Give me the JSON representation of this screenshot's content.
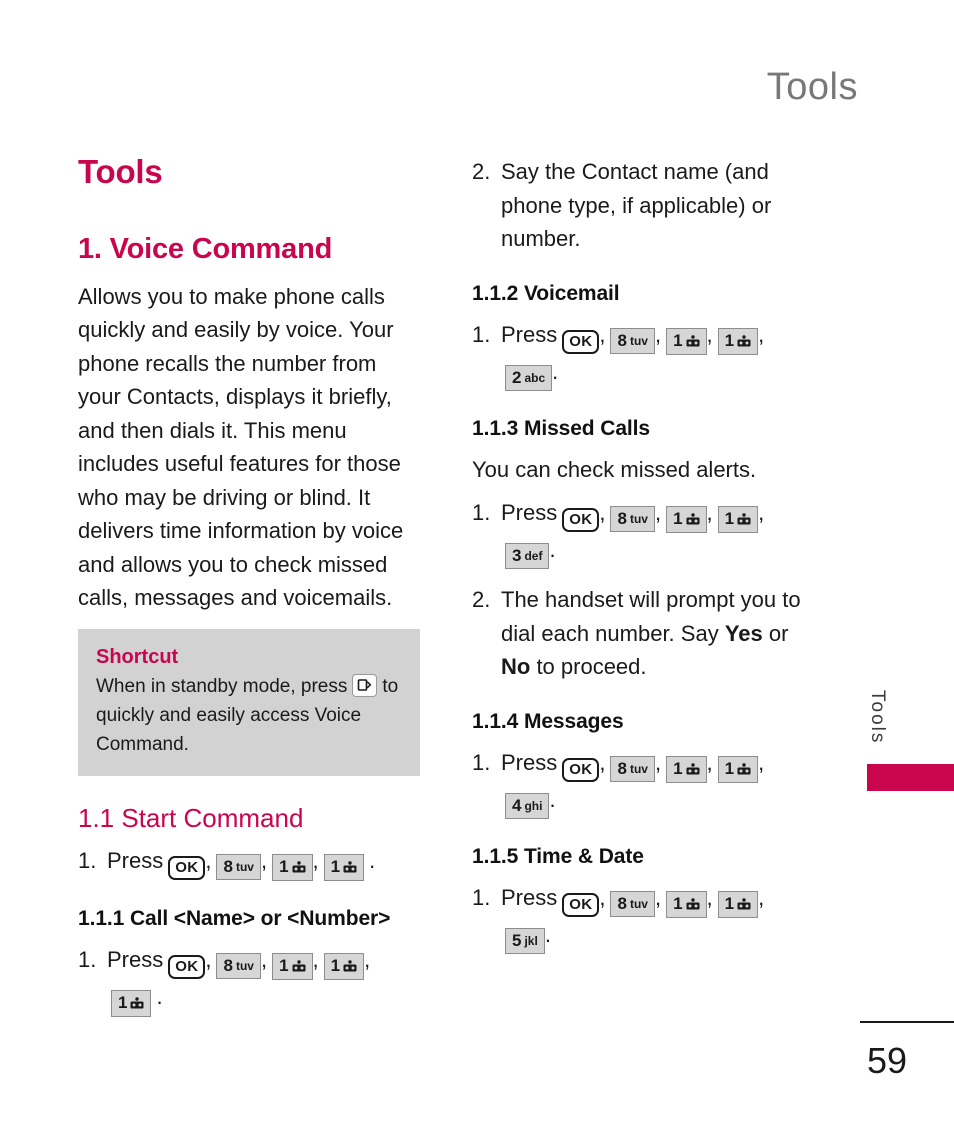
{
  "page": {
    "running_header": "Tools",
    "folio": "59",
    "thumb_tab": "Tools",
    "accent_color": "#c9054e",
    "header_color": "#77787b",
    "callout_bg": "#d2d2d2",
    "key_bg": "#d6d6d6"
  },
  "left_column": {
    "chapter_title": "Tools",
    "section_title": "1. Voice Command",
    "intro_paragraph": "Allows you to make phone calls quickly and easily by voice. Your phone recalls the number from your Contacts, displays it briefly, and then dials it. This menu includes useful features for those who may be driving or blind. It delivers time information by voice and allows you to check missed calls, messages and voicemails.",
    "shortcut": {
      "title": "Shortcut",
      "text_before_key": "When in standby mode, press",
      "key_icon": "voice-command-key-icon",
      "text_after_key": "to quickly and easily access Voice Command."
    },
    "subsection_1_1": {
      "heading": "1.1 Start Command",
      "step_number": "1.",
      "step_verb": "Press",
      "keys": [
        "OK",
        "8 tuv",
        "1",
        "1"
      ],
      "terminator": "."
    },
    "subsection_1_1_1": {
      "heading": "1.1.1 Call <Name> or <Number>",
      "step_number": "1.",
      "step_verb": "Press",
      "keys": [
        "OK",
        "8 tuv",
        "1",
        "1",
        "1"
      ],
      "terminator": "."
    }
  },
  "right_column": {
    "step_2_say_contact": {
      "number": "2.",
      "text": "Say the Contact name (and phone type, if applicable) or number."
    },
    "subsection_1_1_2": {
      "heading": "1.1.2 Voicemail",
      "step_number": "1.",
      "step_verb": "Press",
      "keys": [
        "OK",
        "8 tuv",
        "1",
        "1",
        "2 abc"
      ],
      "terminator": "."
    },
    "subsection_1_1_3": {
      "heading": "1.1.3 Missed Calls",
      "body": "You can check missed alerts.",
      "step_number": "1.",
      "step_verb": "Press",
      "keys": [
        "OK",
        "8 tuv",
        "1",
        "1",
        "3 def"
      ],
      "terminator": ".",
      "step2_number": "2.",
      "step2_part1": "The handset will prompt you to dial each number. Say ",
      "step2_yes": "Yes",
      "step2_part2": " or ",
      "step2_no": "No",
      "step2_part3": " to proceed."
    },
    "subsection_1_1_4": {
      "heading": "1.1.4 Messages",
      "step_number": "1.",
      "step_verb": "Press",
      "keys": [
        "OK",
        "8 tuv",
        "1",
        "1",
        "4 ghi"
      ],
      "terminator": "."
    },
    "subsection_1_1_5": {
      "heading": "1.1.5 Time & Date",
      "step_number": "1.",
      "step_verb": "Press",
      "keys": [
        "OK",
        "8 tuv",
        "1",
        "1",
        "5 jkl"
      ],
      "terminator": "."
    }
  },
  "keys": {
    "ok": "OK",
    "eight_digit": "8",
    "eight_letters": "tuv",
    "one_digit": "1",
    "two_digit": "2",
    "two_letters": "abc",
    "three_digit": "3",
    "three_letters": "def",
    "four_digit": "4",
    "four_letters": "ghi",
    "five_digit": "5",
    "five_letters": "jkl",
    "comma": ",",
    "period": "."
  }
}
